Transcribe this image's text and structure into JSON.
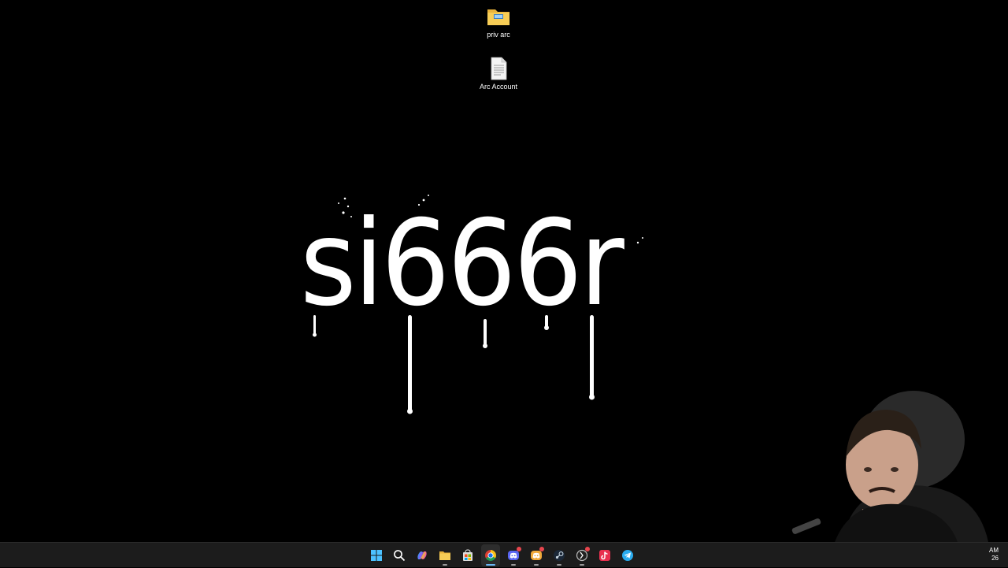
{
  "desktop": {
    "icons": [
      {
        "name": "priv arc",
        "type": "folder"
      },
      {
        "name": "Arc Account",
        "type": "text-file"
      }
    ],
    "wallpaper_text": "si666r"
  },
  "taskbar": {
    "apps": [
      {
        "id": "start",
        "icon": "windows-start-icon"
      },
      {
        "id": "search",
        "icon": "search-icon"
      },
      {
        "id": "copilot",
        "icon": "copilot-icon"
      },
      {
        "id": "file-explorer",
        "icon": "folder-icon"
      },
      {
        "id": "store",
        "icon": "store-icon"
      },
      {
        "id": "chrome",
        "icon": "chrome-icon",
        "active": true
      },
      {
        "id": "discord",
        "icon": "discord-icon",
        "badge": true
      },
      {
        "id": "discord-canary",
        "icon": "discord-yellow-icon",
        "badge": true
      },
      {
        "id": "steam",
        "icon": "steam-icon"
      },
      {
        "id": "app-dark",
        "icon": "dark-app-icon",
        "badge": true
      },
      {
        "id": "tiktok",
        "icon": "tiktok-icon"
      },
      {
        "id": "telegram",
        "icon": "telegram-icon"
      }
    ],
    "clock": {
      "line1": "AM",
      "line2": "26"
    }
  },
  "colors": {
    "desktop_bg": "#000000",
    "taskbar_bg": "#1c1c1c",
    "accent": "#6cb8f6",
    "badge": "#e8464e"
  }
}
